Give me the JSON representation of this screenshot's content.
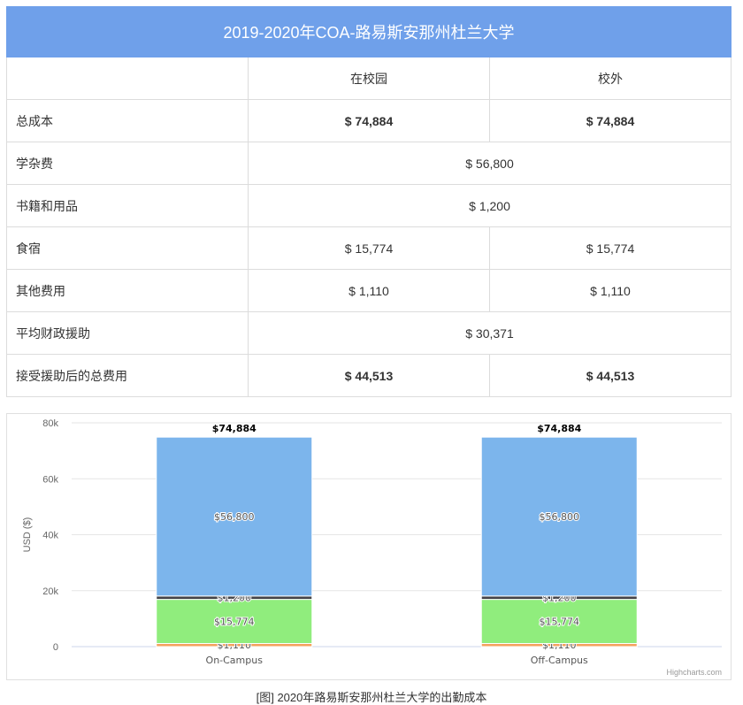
{
  "table": {
    "title": "2019-2020年COA-路易斯安那州杜兰大学",
    "col_headers": [
      "",
      "在校园",
      "校外"
    ],
    "rows": [
      {
        "label": "总成本",
        "on": "$ 74,884",
        "off": "$ 74,884",
        "bold": true
      },
      {
        "label": "学杂费",
        "both": "$ 56,800"
      },
      {
        "label": "书籍和用品",
        "both": "$ 1,200"
      },
      {
        "label": "食宿",
        "on": "$ 15,774",
        "off": "$ 15,774"
      },
      {
        "label": "其他费用",
        "on": "$ 1,110",
        "off": "$ 1,110"
      },
      {
        "label": "平均财政援助",
        "both": "$ 30,371"
      },
      {
        "label": "接受援助后的总费用",
        "on": "$ 44,513",
        "off": "$ 44,513",
        "bold": true
      }
    ]
  },
  "chart_data": {
    "type": "bar",
    "stacked": true,
    "categories": [
      "On-Campus",
      "Off-Campus"
    ],
    "series": [
      {
        "name": "",
        "values": [
          1110,
          1110
        ],
        "labels": [
          "$1,110",
          "$1,110"
        ],
        "color": "#f4a15d"
      },
      {
        "name": "",
        "values": [
          15774,
          15774
        ],
        "labels": [
          "$15,774",
          "$15,774"
        ],
        "color": "#90ed7d"
      },
      {
        "name": "",
        "values": [
          1200,
          1200
        ],
        "labels": [
          "$1,200",
          "$1,200"
        ],
        "color": "#434348"
      },
      {
        "name": "",
        "values": [
          56800,
          56800
        ],
        "labels": [
          "$56,800",
          "$56,800"
        ],
        "color": "#7cb5ec"
      }
    ],
    "totals": [
      "$74,884",
      "$74,884"
    ],
    "ylabel": "USD ($)",
    "ylim": [
      0,
      80000
    ],
    "yticks": [
      0,
      20000,
      40000,
      60000,
      80000
    ],
    "ytick_labels": [
      "0",
      "20k",
      "40k",
      "60k",
      "80k"
    ],
    "grid": true,
    "credits": "Highcharts.com"
  },
  "caption": "[图] 2020年路易斯安那州杜兰大学的出勤成本"
}
